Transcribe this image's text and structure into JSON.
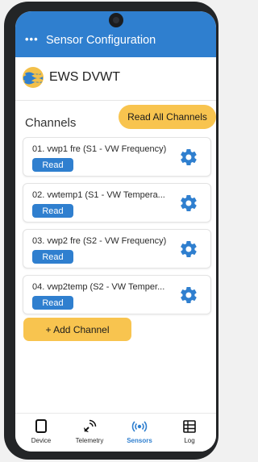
{
  "appbar": {
    "menu_label": "•••",
    "title": "Sensor Configuration"
  },
  "brand": {
    "name": "EWS DVWT"
  },
  "channels": {
    "label": "Channels",
    "read_all_label": "Read All Channels",
    "add_label": "+ Add Channel",
    "items": [
      {
        "name": "01. vwp1 fre (S1 - VW Frequency)",
        "read_label": "Read"
      },
      {
        "name": "02. vwtemp1 (S1 - VW Tempera...",
        "read_label": "Read"
      },
      {
        "name": "03. vwp2 fre (S2 - VW Frequency)",
        "read_label": "Read"
      },
      {
        "name": "04. vwp2temp (S2 - VW Temper...",
        "read_label": "Read"
      }
    ]
  },
  "nav": {
    "items": [
      {
        "label": "Device",
        "icon": "phone-icon"
      },
      {
        "label": "Telemetry",
        "icon": "satellite-icon"
      },
      {
        "label": "Sensors",
        "icon": "signal-icon",
        "active": true
      },
      {
        "label": "Log",
        "icon": "log-icon"
      }
    ]
  },
  "colors": {
    "primary": "#2f7fcf",
    "accent": "#f8c44f",
    "frame": "#232527"
  }
}
